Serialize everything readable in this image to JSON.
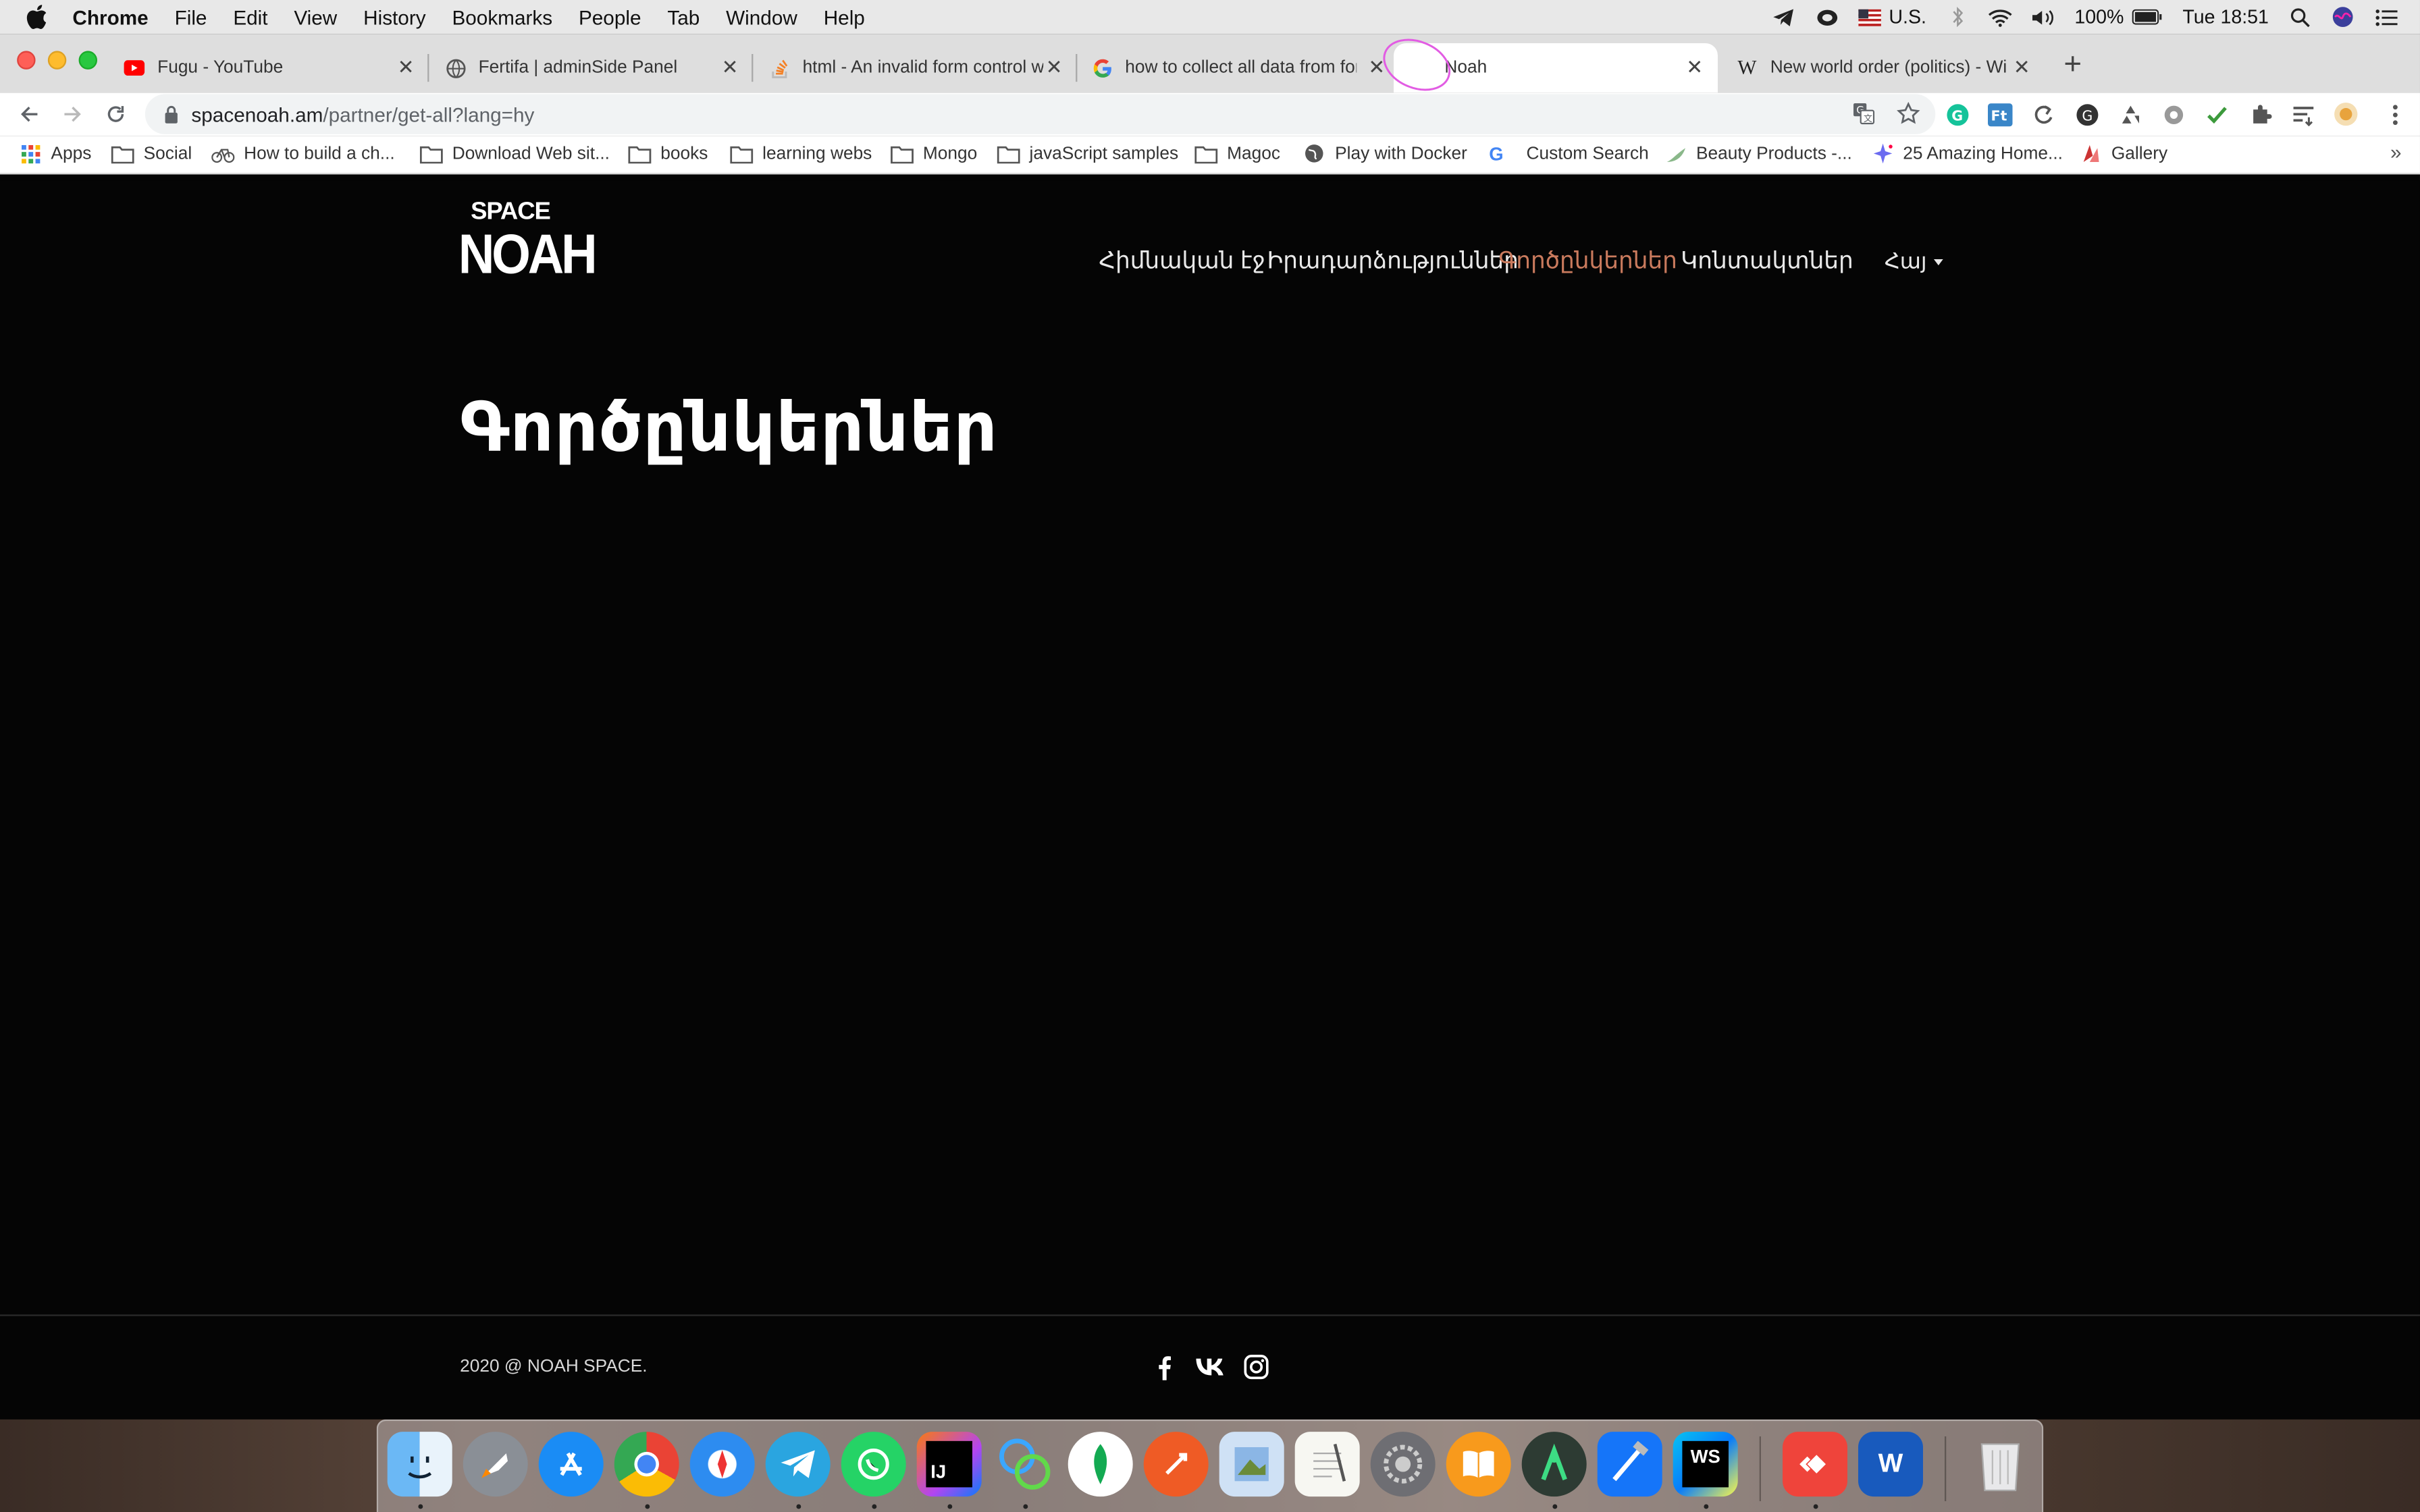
{
  "menubar": {
    "app_name": "Chrome",
    "menus": [
      "File",
      "Edit",
      "View",
      "History",
      "Bookmarks",
      "People",
      "Tab",
      "Window",
      "Help"
    ],
    "input_source": "U.S.",
    "battery": "100%",
    "clock": "Tue 18:51"
  },
  "tabs": [
    {
      "title": "Fugu - YouTube",
      "icon": "youtube-icon"
    },
    {
      "title": "Fertifa | adminSide Panel",
      "icon": "globe-icon"
    },
    {
      "title": "html - An invalid form control w",
      "icon": "stackoverflow-icon"
    },
    {
      "title": "how to collect all data from for",
      "icon": "google-icon"
    },
    {
      "title": "Noah",
      "icon": "blank-icon",
      "active": true
    },
    {
      "title": "New world order (politics) - Wi",
      "icon": "wikipedia-icon"
    }
  ],
  "omnibox": {
    "host": "spacenoah.am",
    "path": "/partner/get-all?lang=hy"
  },
  "bookmarks": [
    {
      "label": "Apps",
      "icon": "apps-grid-icon"
    },
    {
      "label": "Social",
      "icon": "folder-icon"
    },
    {
      "label": "How to build a ch...",
      "icon": "bike-icon"
    },
    {
      "label": "Download Web sit...",
      "icon": "folder-icon"
    },
    {
      "label": "books",
      "icon": "folder-icon"
    },
    {
      "label": "learning webs",
      "icon": "folder-icon"
    },
    {
      "label": "Mongo",
      "icon": "folder-icon"
    },
    {
      "label": "javaScript samples",
      "icon": "folder-icon"
    },
    {
      "label": "Magoc",
      "icon": "folder-icon"
    },
    {
      "label": "Play with Docker",
      "icon": "globe-icon"
    },
    {
      "label": "Custom Search",
      "icon": "google-icon"
    },
    {
      "label": "Beauty Products -...",
      "icon": "leaf-icon"
    },
    {
      "label": "25 Amazing Home...",
      "icon": "sparkle-icon"
    },
    {
      "label": "Gallery",
      "icon": "gallery-icon"
    }
  ],
  "bookmarks_more": "»",
  "site": {
    "logo_top": "SPACE",
    "logo_bottom": "NOAH",
    "nav": [
      {
        "label": "Հիմնական էջ"
      },
      {
        "label": "Իրադարձություններ"
      },
      {
        "label": "Գործընկերներ",
        "active": true
      },
      {
        "label": "Կոնտակտներ"
      }
    ],
    "language": "Հայ",
    "heading": "Գործընկերներ",
    "copyright": "2020 @ NOAH SPACE.",
    "social": [
      "facebook-icon",
      "vk-icon",
      "instagram-icon"
    ],
    "accent_color": "#c97a5d",
    "background_color": "#050505"
  },
  "dock_apps": [
    "finder-icon",
    "launchpad-icon",
    "app-store-icon",
    "chrome-icon",
    "safari-icon",
    "telegram-icon",
    "whatsapp-icon",
    "intellij-icon",
    "pycharm-like-icon",
    "mongodb-compass-icon",
    "postman-icon",
    "preview-icon",
    "textedit-icon",
    "system-preferences-icon",
    "books-icon",
    "android-studio-icon",
    "xcode-icon",
    "webstorm-icon",
    "anydesk-icon",
    "word-icon",
    "trash-icon"
  ],
  "dock_labels": {
    "intellij": "IJ",
    "webstorm": "WS",
    "word": "W"
  }
}
